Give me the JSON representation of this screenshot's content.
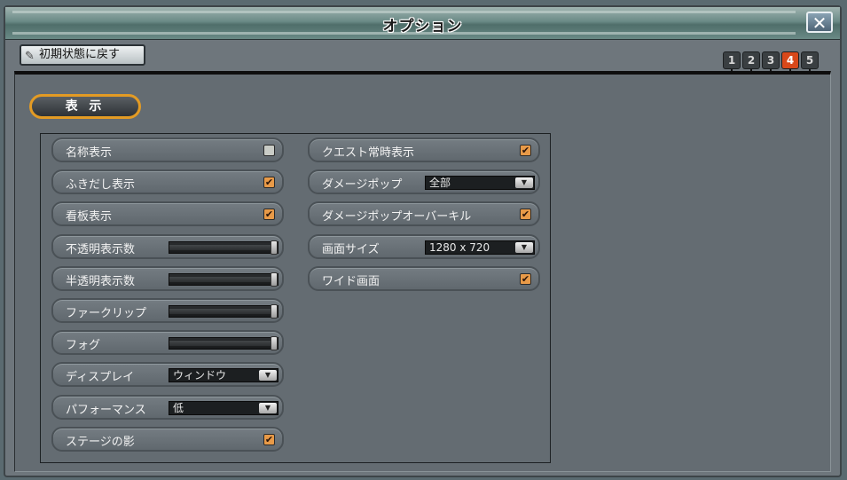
{
  "window": {
    "title": "オプション",
    "close_label": "✕"
  },
  "toolbar": {
    "reset_label": "初期状態に戻す"
  },
  "page_tabs": [
    {
      "label": "1",
      "active": false
    },
    {
      "label": "2",
      "active": false
    },
    {
      "label": "3",
      "active": false
    },
    {
      "label": "4",
      "active": true
    },
    {
      "label": "5",
      "active": false
    }
  ],
  "section": {
    "title": "表 示"
  },
  "left_column": [
    {
      "label": "名称表示",
      "type": "checkbox",
      "checked": false
    },
    {
      "label": "ふきだし表示",
      "type": "checkbox",
      "checked": true
    },
    {
      "label": "看板表示",
      "type": "checkbox",
      "checked": true
    },
    {
      "label": "不透明表示数",
      "type": "slider",
      "level": 1.0
    },
    {
      "label": "半透明表示数",
      "type": "slider",
      "level": 1.0
    },
    {
      "label": "ファークリップ",
      "type": "slider",
      "level": 1.0
    },
    {
      "label": "フォグ",
      "type": "slider",
      "level": 1.0
    },
    {
      "label": "ディスプレイ",
      "type": "select",
      "value": "ウィンドウ"
    },
    {
      "label": "パフォーマンス",
      "type": "select",
      "value": "低"
    },
    {
      "label": "ステージの影",
      "type": "checkbox",
      "checked": true
    }
  ],
  "right_column": [
    {
      "label": "クエスト常時表示",
      "type": "checkbox",
      "checked": true
    },
    {
      "label": "ダメージポップ",
      "type": "select",
      "value": "全部"
    },
    {
      "label": "ダメージポップオーバーキル",
      "type": "checkbox",
      "checked": true
    },
    {
      "label": "画面サイズ",
      "type": "select",
      "value": "1280 x 720"
    },
    {
      "label": "ワイド画面",
      "type": "checkbox",
      "checked": true
    }
  ],
  "colors": {
    "accent_orange": "#e39b24",
    "checkbox_orange": "#e89a48",
    "active_tab": "#d8481a"
  }
}
